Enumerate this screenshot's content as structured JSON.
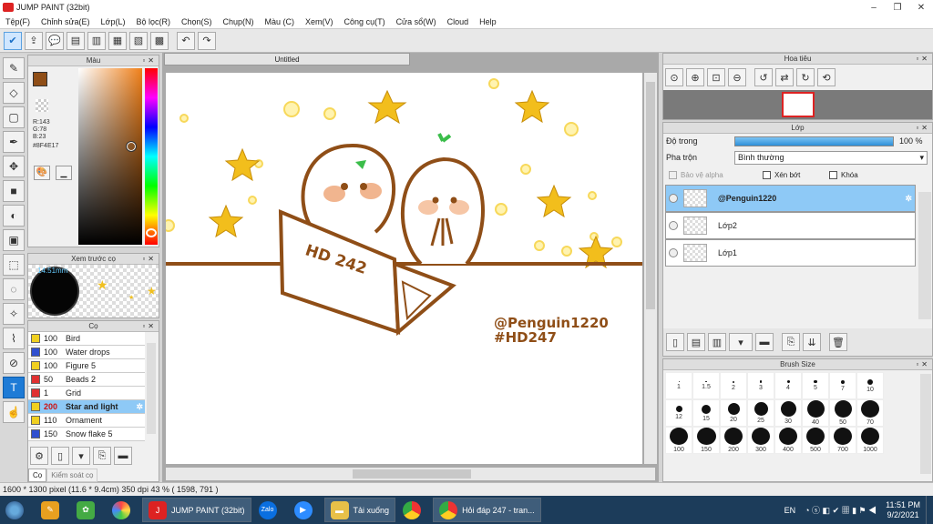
{
  "window": {
    "title": "JUMP PAINT (32bit)"
  },
  "menu": [
    "Tệp(F)",
    "Chỉnh sửa(E)",
    "Lớp(L)",
    "Bộ lọc(R)",
    "Chọn(S)",
    "Chụp(N)",
    "Màu (C)",
    "Xem(V)",
    "Công cụ(T)",
    "Cửa sổ(W)",
    "Cloud",
    "Help"
  ],
  "color_panel": {
    "title": "Màu",
    "r": "R:143",
    "g": "G:78",
    "b": "B:23",
    "hex": "#8F4E17",
    "main_color": "#8F4E17"
  },
  "preview_panel": {
    "title": "Xem trước cọ",
    "size": "14.51mm"
  },
  "brush_panel": {
    "title": "Cọ",
    "items": [
      {
        "size": "100",
        "name": "Bird",
        "color": "#f0d020"
      },
      {
        "size": "100",
        "name": "Water drops",
        "color": "#3050d0"
      },
      {
        "size": "100",
        "name": "Figure 5",
        "color": "#f0d020"
      },
      {
        "size": "50",
        "name": "Beads 2",
        "color": "#e03030"
      },
      {
        "size": "1",
        "name": "Grid",
        "color": "#e03030"
      },
      {
        "size": "200",
        "name": "Star and light",
        "color": "#f0d020"
      },
      {
        "size": "110",
        "name": "Ornament",
        "color": "#f0d020"
      },
      {
        "size": "150",
        "name": "Snow flake 5",
        "color": "#3050d0"
      }
    ],
    "tab1": "Cọ",
    "tab2": "Kiểm soát cọ"
  },
  "document": {
    "tab": "Untitled"
  },
  "artwork": {
    "laptop_text": "HD 242",
    "signature": "@Penguin1220",
    "tag": "#HD247"
  },
  "nav_panel": {
    "title": "Hoa tiêu"
  },
  "layer_panel": {
    "title": "Lớp",
    "opacity_label": "Độ trong",
    "opacity_value": "100 %",
    "opacity_fraction": 1.0,
    "blend_label": "Pha trộn",
    "blend_value": "Bình thường",
    "protect_alpha": "Bảo vệ alpha",
    "clip": "Xén bớt",
    "lock": "Khóa",
    "layers": [
      {
        "name": "@Penguin1220",
        "selected": true
      },
      {
        "name": "Lớp2",
        "selected": false
      },
      {
        "name": "Lớp1",
        "selected": false
      }
    ]
  },
  "brush_size_panel": {
    "title": "Brush Size",
    "sizes": [
      "1",
      "1.5",
      "2",
      "3",
      "4",
      "5",
      "7",
      "10",
      "12",
      "15",
      "20",
      "25",
      "30",
      "40",
      "50",
      "70",
      "100",
      "150",
      "200",
      "300",
      "400",
      "500",
      "700",
      "1000"
    ]
  },
  "status": {
    "text": "1600 * 1300 pixel  (11.6 * 9.4cm)  350 dpi  43 %  ( 1598, 791 )"
  },
  "taskbar": {
    "items": [
      "JUMP PAINT (32bit)",
      "Tải xuống",
      "Hỏi đáp 247 - tran..."
    ],
    "zalo": "Zalo",
    "lang": "EN",
    "time": "11:51 PM",
    "date": "9/2/2021"
  }
}
